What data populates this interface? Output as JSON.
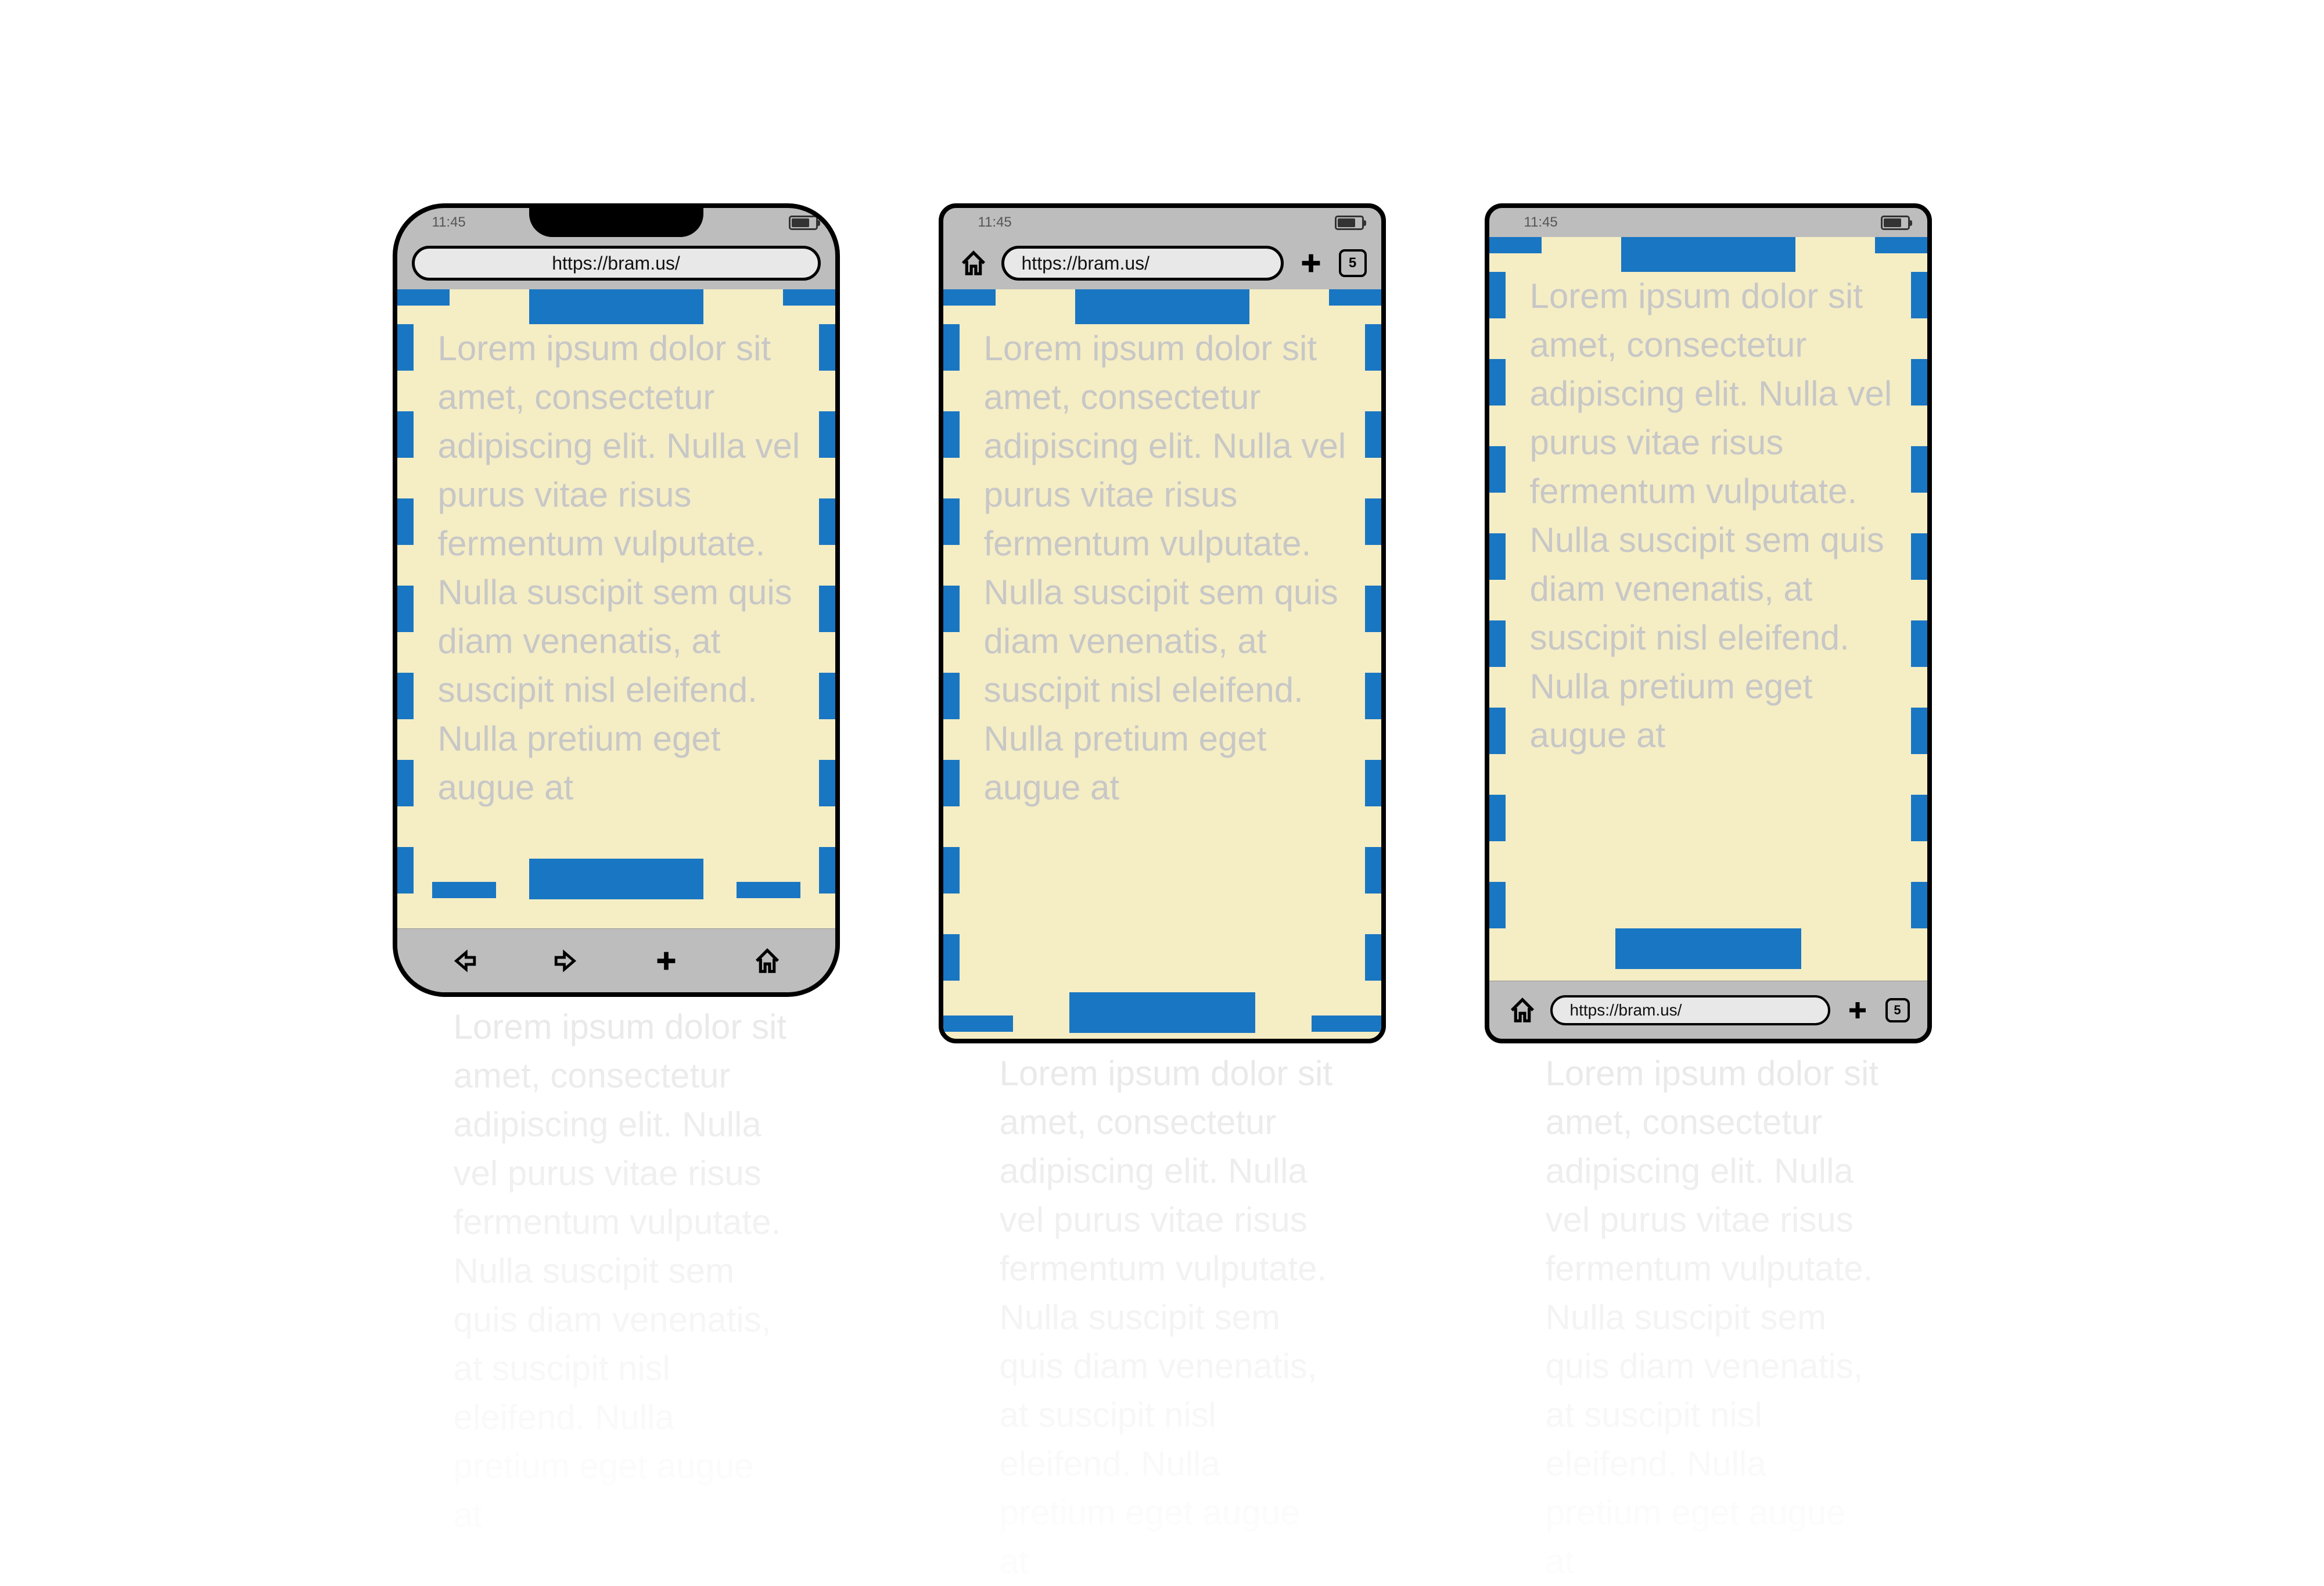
{
  "status_time": "11:45",
  "url": "https://bram.us/",
  "tab_count": "5",
  "lorem_text": "Lorem ipsum dolor sit amet, consectetur adipiscing elit. Nulla vel purus vitae risus fermentum vulputate. Nulla suscipit sem quis diam venenatis, at suscipit nisl eleifend. Nulla pretium eget augue at",
  "phones": [
    {
      "id": "phone-a",
      "style": "notch-rounded",
      "top_chrome": "url_only_centered",
      "bottom_chrome": "nav_icons",
      "viewport_height_visual": "short"
    },
    {
      "id": "phone-b",
      "style": "plain-rounded-small",
      "top_chrome": "home_url_plus_tabs",
      "bottom_chrome": "none",
      "viewport_height_visual": "tall"
    },
    {
      "id": "phone-c",
      "style": "plain-rounded-small",
      "top_chrome": "status_only",
      "bottom_chrome": "home_url_plus_tabs",
      "viewport_height_visual": "tall"
    }
  ],
  "diagram_meaning": "Three mobile browser chrome layouts illustrating how viewport / safe-area differs; the dashed blue outline marks the layout viewport, the solid blue center bars mark fixed-positioned elements relative to viewport edges."
}
